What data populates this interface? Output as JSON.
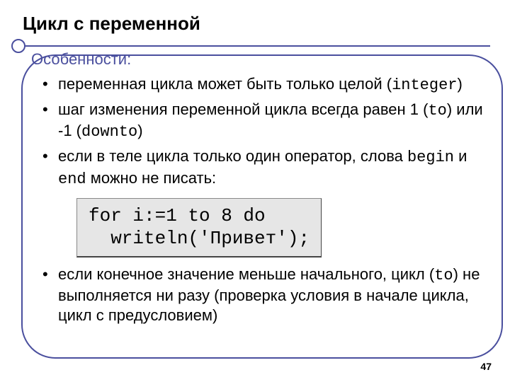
{
  "title": "Цикл с переменной",
  "subtitle": "Особенности:",
  "bullets": {
    "b1": {
      "pre": "переменная цикла может быть только целой (",
      "code": "integer",
      "post": ")"
    },
    "b2": {
      "pre": "шаг изменения переменной цикла всегда равен 1 (",
      "code1": "to",
      "mid": ") или -1 (",
      "code2": "downto",
      "post": ")"
    },
    "b3": {
      "pre": "если в теле цикла только один оператор, слова ",
      "code1": "begin",
      "mid": " и ",
      "code2": "end",
      "post": " можно не писать:"
    },
    "b4": {
      "pre": "если конечное значение меньше начального, цикл (",
      "code": "to",
      "post": ") не выполняется ни разу (проверка условия в начале цикла, цикл с предусловием)"
    }
  },
  "code_sample": "for i:=1 to 8 do\n  writeln('Привет');",
  "page_number": "47"
}
